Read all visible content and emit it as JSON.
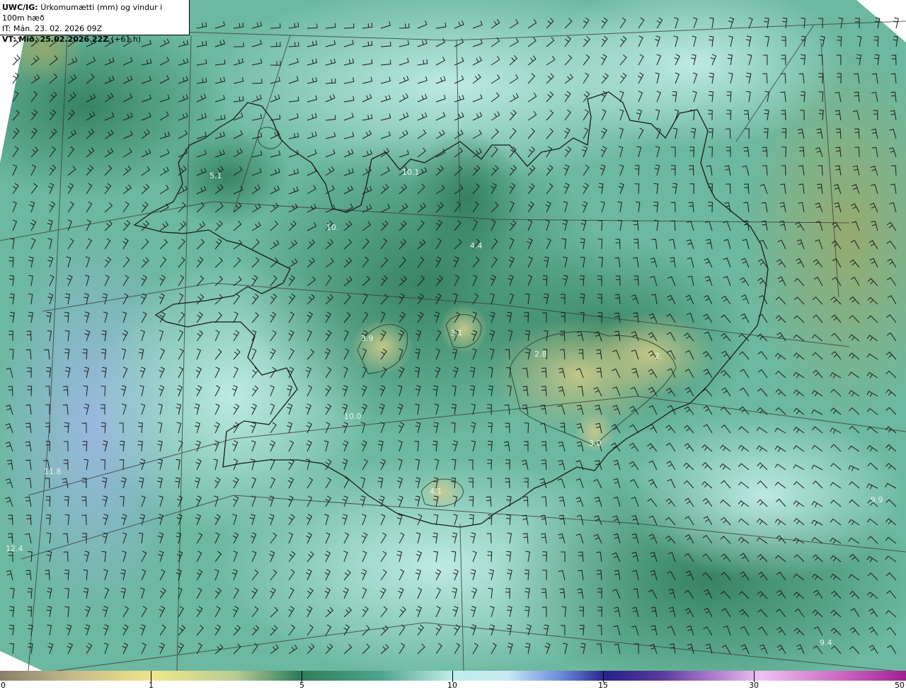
{
  "header": {
    "model": "UWC/IG:",
    "title": "Úrkomumætti (mm) og vindur i 100m hæð",
    "issue_time": "IT: Mán. 23. 02. 2026 09Z",
    "valid_prefix": "VT:",
    "valid_time": "Mið. 25.02.2026 22Z",
    "lead": "(+61 h)"
  },
  "value_labels": [
    "5.1",
    "10.1",
    "10.",
    "4.4",
    "3.9",
    "3.1",
    "2.8",
    "2.",
    "3.0",
    "4.1",
    "11.8",
    "12.4",
    "9.9",
    "9.4",
    "10.0"
  ],
  "colorbar": {
    "ticks": [
      "0",
      "1",
      "5",
      "10",
      "15",
      "30",
      "50"
    ],
    "colors": [
      "#8b7d6b",
      "#c7b98a",
      "#f0e68c",
      "#c8d49a",
      "#7fb89a",
      "#3d8a6a",
      "#2e7d5b",
      "#4fa48c",
      "#8fd0c6",
      "#bfeee8",
      "#c8e8f4",
      "#8aa8e0",
      "#5060c8",
      "#28208c",
      "#4a2a8a",
      "#a060c0",
      "#e0a0e0",
      "#d070c8",
      "#a02090"
    ],
    "accent": "#2e7d5b"
  }
}
